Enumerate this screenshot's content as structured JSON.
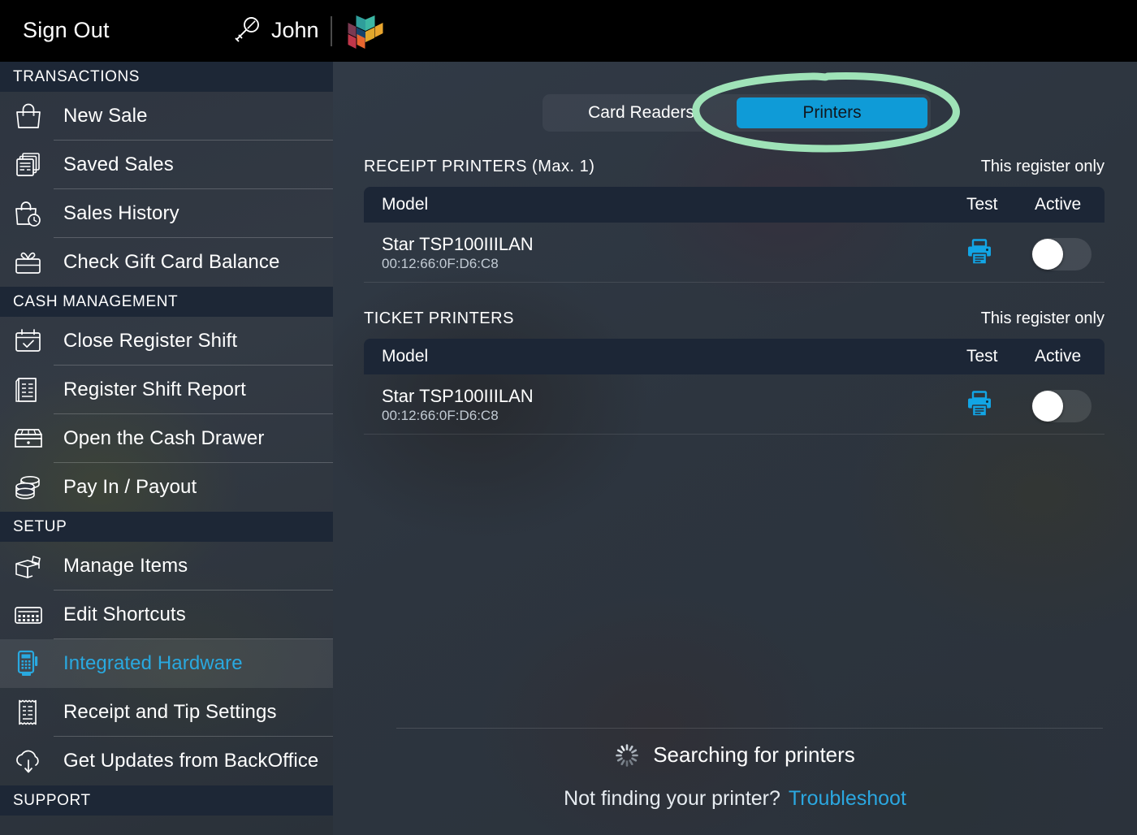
{
  "topbar": {
    "sign_out": "Sign Out",
    "user_name": "John",
    "key_icon": "key-icon",
    "logo": "brand-logo"
  },
  "sidebar": {
    "sections": [
      {
        "title": "TRANSACTIONS",
        "items": [
          {
            "label": "New Sale",
            "icon": "shopping-bag-icon",
            "active": false
          },
          {
            "label": "Saved Sales",
            "icon": "stacked-documents-icon",
            "active": false
          },
          {
            "label": "Sales History",
            "icon": "bag-clock-icon",
            "active": false
          },
          {
            "label": "Check Gift Card Balance",
            "icon": "gift-card-icon",
            "active": false
          }
        ]
      },
      {
        "title": "CASH MANAGEMENT",
        "items": [
          {
            "label": "Close Register Shift",
            "icon": "calendar-check-icon",
            "active": false
          },
          {
            "label": "Register Shift Report",
            "icon": "report-document-icon",
            "active": false
          },
          {
            "label": "Open the Cash Drawer",
            "icon": "cash-drawer-icon",
            "active": false
          },
          {
            "label": "Pay In / Payout",
            "icon": "coin-stack-icon",
            "active": false
          }
        ]
      },
      {
        "title": "SETUP",
        "items": [
          {
            "label": "Manage Items",
            "icon": "open-box-icon",
            "active": false
          },
          {
            "label": "Edit Shortcuts",
            "icon": "keypad-grid-icon",
            "active": false
          },
          {
            "label": "Integrated Hardware",
            "icon": "card-terminal-icon",
            "active": true
          },
          {
            "label": "Receipt and Tip Settings",
            "icon": "receipt-icon",
            "active": false
          },
          {
            "label": "Get Updates from BackOffice",
            "icon": "cloud-download-icon",
            "active": false
          }
        ]
      },
      {
        "title": "SUPPORT",
        "items": []
      }
    ]
  },
  "main": {
    "tabs": [
      {
        "label": "Card Readers",
        "selected": false
      },
      {
        "label": "Printers",
        "selected": true
      }
    ],
    "annotation": {
      "shape": "green-ellipse-highlight",
      "color": "#9fe3b8"
    },
    "sections": [
      {
        "title": "RECEIPT PRINTERS (Max. 1)",
        "note": "This register only",
        "columns": {
          "model": "Model",
          "test": "Test",
          "active": "Active"
        },
        "rows": [
          {
            "model": "Star TSP100IIILAN",
            "mac": "00:12:66:0F:D6:C8",
            "test_icon": "printer-icon",
            "active": false
          }
        ]
      },
      {
        "title": "TICKET PRINTERS",
        "note": "This register only",
        "columns": {
          "model": "Model",
          "test": "Test",
          "active": "Active"
        },
        "rows": [
          {
            "model": "Star TSP100IIILAN",
            "mac": "00:12:66:0F:D6:C8",
            "test_icon": "printer-icon",
            "active": false
          }
        ]
      }
    ],
    "footer": {
      "searching_text": "Searching for printers",
      "spinner_icon": "loading-spinner-icon",
      "not_finding_text": "Not finding your printer?",
      "troubleshoot_link": "Troubleshoot"
    }
  },
  "colors": {
    "accent_blue": "#0f9bd7",
    "link_blue": "#2ba7e0",
    "section_header_bg": "#1d2736",
    "table_header_bg": "#1c2636",
    "annotation_green": "#9fe3b8",
    "topbar_bg": "#000000"
  }
}
